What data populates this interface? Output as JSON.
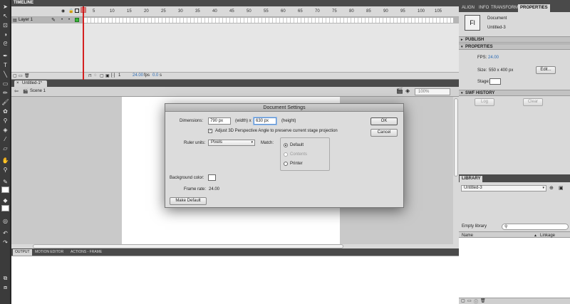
{
  "timeline": {
    "tab_label": "TIMELINE",
    "frame_numbers": [
      "5",
      "10",
      "15",
      "20",
      "25",
      "30",
      "35",
      "40",
      "45",
      "50",
      "55",
      "60",
      "65",
      "70",
      "75",
      "80",
      "85",
      "90",
      "95",
      "100",
      "105"
    ],
    "layer_name": "Layer 1",
    "current_frame": "1",
    "fps": "24.00",
    "fps_unit": "fps",
    "time": "0.0",
    "time_unit": "s"
  },
  "document_tab": {
    "label": "Untitled-1*",
    "close": "×"
  },
  "edit_bar": {
    "scene": "Scene 1",
    "zoom": "100%"
  },
  "bottom_tabs": [
    "OUTPUT",
    "MOTION EDITOR",
    "ACTIONS - FRAME"
  ],
  "right_tabs": [
    "ALIGN",
    "INFO",
    "TRANSFORM",
    "PROPERTIES"
  ],
  "properties": {
    "icon_text": "Fl",
    "doc_type": "Document",
    "doc_name": "Untitled-3",
    "publish_section": "PUBLISH",
    "properties_section": "PROPERTIES",
    "fps_label": "FPS:",
    "fps_value": "24.00",
    "size_label": "Size:",
    "size_value": "550 x 400 px",
    "edit_button": "Edit...",
    "stage_label": "Stage:",
    "swf_section": "SWF HISTORY",
    "log_button": "Log",
    "clear_button": "Clear"
  },
  "library": {
    "tab_label": "LIBRARY",
    "selected_doc": "Untitled-3",
    "empty_text": "Empty library",
    "col_name": "Name",
    "col_linkage": "Linkage"
  },
  "dialog": {
    "title": "Document Settings",
    "dimensions_label": "Dimensions:",
    "width_value": "790 px",
    "width_label": "(width) x",
    "height_value": "630 px",
    "height_label": "(height)",
    "adjust_3d_label": "Adjust 3D Perspective Angle to preserve current stage projection",
    "ruler_label": "Ruler units:",
    "ruler_value": "Pixels",
    "match_label": "Match:",
    "match_options": [
      "Default",
      "Contents",
      "Printer"
    ],
    "bg_label": "Background color:",
    "frame_rate_label": "Frame rate:",
    "frame_rate_value": "24.00",
    "make_default": "Make Default",
    "ok": "OK",
    "cancel": "Cancel"
  }
}
